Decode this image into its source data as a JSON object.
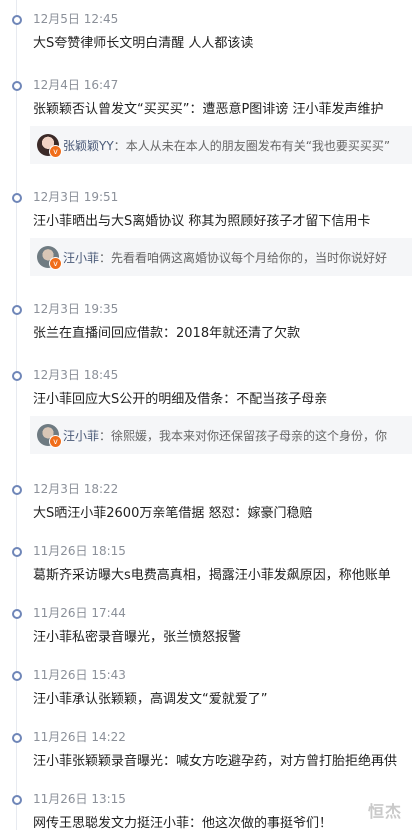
{
  "items": [
    {
      "time": "12月5日 12:45",
      "title": "大S夸赞律师长文明白清醒 人人都该读"
    },
    {
      "time": "12月4日 16:47",
      "title": "张颖颖否认曾发文“买买买”：遭恶意P图诽谤 汪小菲发声维护",
      "comment": {
        "name": "张颖颖YY",
        "sep": "：",
        "text": "本人从未在本人的朋友圈发布有关“我也要买买买”"
      }
    },
    {
      "time": "12月3日 19:51",
      "title": "汪小菲晒出与大S离婚协议 称其为照顾好孩子才留下信用卡",
      "comment": {
        "name": "汪小菲",
        "sep": "：",
        "text": "先看看咱俩这离婚协议每个月给你的，当时你说好好"
      }
    },
    {
      "time": "12月3日 19:35",
      "title": "张兰在直播间回应借款：2018年就还清了欠款"
    },
    {
      "time": "12月3日 18:45",
      "title": "汪小菲回应大S公开的明细及借条：不配当孩子母亲",
      "comment": {
        "name": "汪小菲",
        "sep": "：",
        "text": "徐熙媛，我本来对你还保留孩子母亲的这个身份，你"
      }
    },
    {
      "time": "12月3日 18:22",
      "title": "大S晒汪小菲2600万亲笔借据 怒怼：嫁豪门稳赔"
    },
    {
      "time": "11月26日 18:15",
      "title": "葛斯齐采访曝大s电费高真相，揭露汪小菲发飙原因，称他账单"
    },
    {
      "time": "11月26日 17:44",
      "title": "汪小菲私密录音曝光，张兰愤怒报警"
    },
    {
      "time": "11月26日 15:43",
      "title": "汪小菲承认张颖颖，高调发文“爱就爱了”"
    },
    {
      "time": "11月26日 14:22",
      "title": "汪小菲张颖颖录音曝光：喊女方吃避孕药，对方曾打胎拒绝再供"
    },
    {
      "time": "11月26日 13:15",
      "title": "网传王思聪发文力挺汪小菲：他这次做的事挺爷们！"
    }
  ],
  "watermark": "恒杰"
}
